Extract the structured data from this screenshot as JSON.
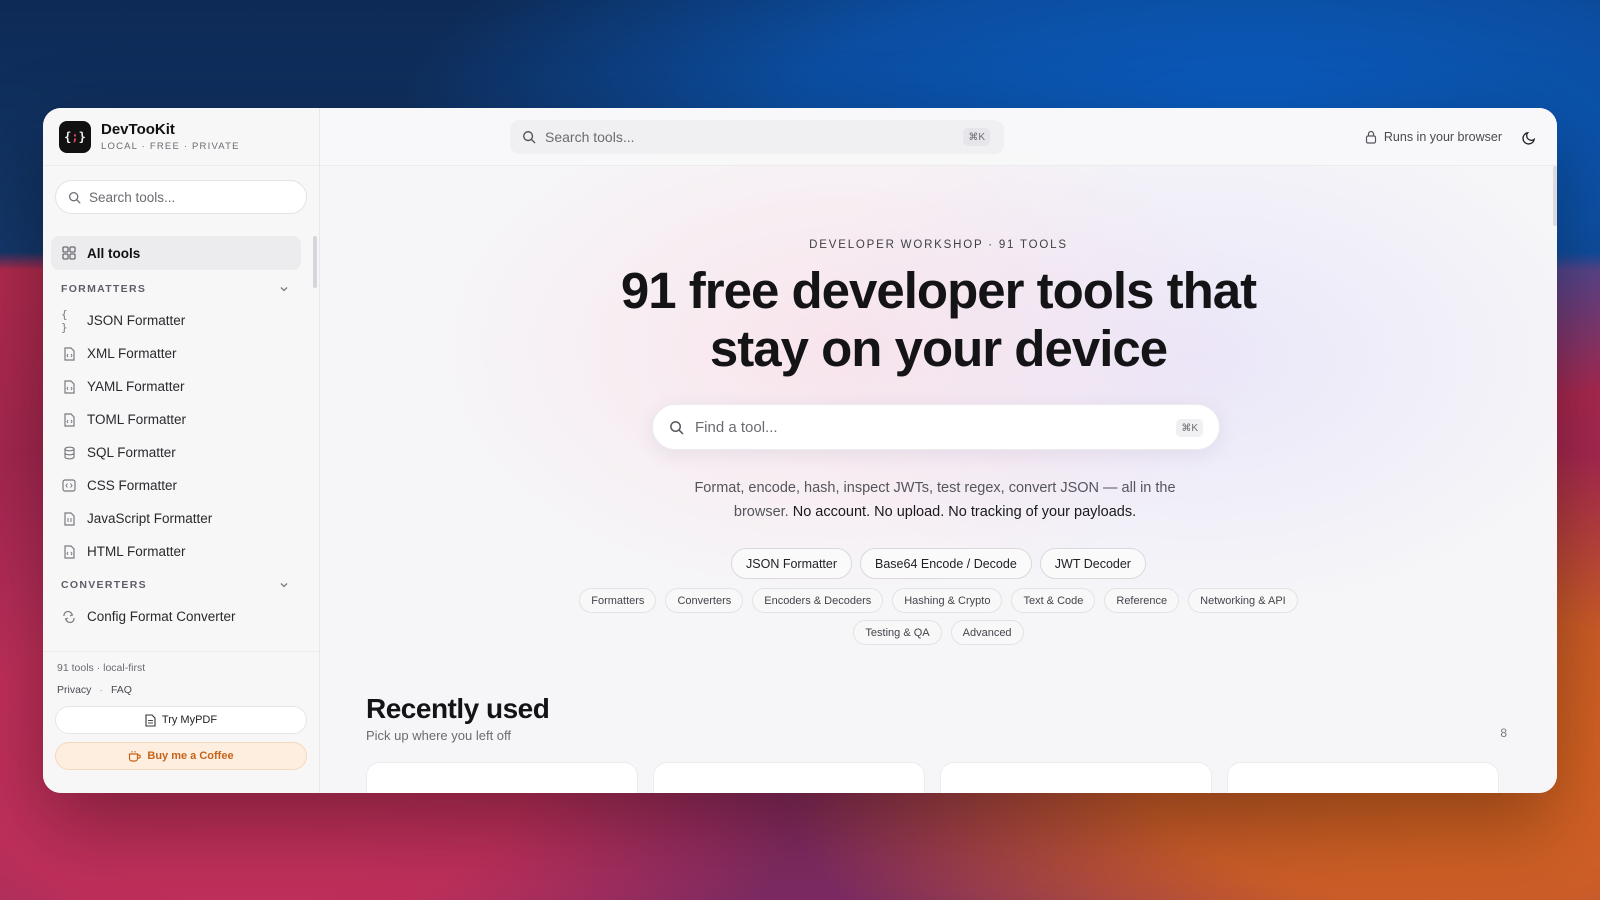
{
  "brand": {
    "name": "DevTooKit",
    "tagline": "LOCAL · FREE · PRIVATE",
    "logo_text_left": "{",
    "logo_text_mid": ";",
    "logo_text_right": "}"
  },
  "sidebar": {
    "search_placeholder": "Search tools...",
    "all_tools_label": "All tools",
    "sections": [
      {
        "title": "FORMATTERS",
        "items": [
          {
            "label": "JSON Formatter",
            "icon": "braces-icon"
          },
          {
            "label": "XML Formatter",
            "icon": "file-code-icon"
          },
          {
            "label": "YAML Formatter",
            "icon": "file-code-icon"
          },
          {
            "label": "TOML Formatter",
            "icon": "file-code-icon"
          },
          {
            "label": "SQL Formatter",
            "icon": "database-icon"
          },
          {
            "label": "CSS Formatter",
            "icon": "code-box-icon"
          },
          {
            "label": "JavaScript Formatter",
            "icon": "file-code-icon"
          },
          {
            "label": "HTML Formatter",
            "icon": "file-code-icon"
          }
        ]
      },
      {
        "title": "CONVERTERS",
        "items": [
          {
            "label": "Config Format Converter",
            "icon": "convert-arrows-icon"
          }
        ]
      }
    ],
    "footer": {
      "meta": "91 tools · local-first",
      "privacy": "Privacy",
      "separator": "·",
      "faq": "FAQ",
      "mypdf_label": "Try MyPDF",
      "coffee_label": "Buy me a Coffee"
    }
  },
  "topbar": {
    "search_placeholder": "Search tools...",
    "shortcut": "⌘K",
    "runs_label": "Runs in your browser"
  },
  "hero": {
    "eyebrow": "DEVELOPER WORKSHOP · 91 TOOLS",
    "headline_line1": "91 free developer tools that",
    "headline_line2": "stay on your device",
    "find_placeholder": "Find a tool...",
    "find_shortcut": "⌘K",
    "subtext_plain": "Format, encode, hash, inspect JWTs, test regex, convert JSON — all in the browser.",
    "subtext_strong": "No account. No upload. No tracking of your payloads.",
    "featured": [
      "JSON Formatter",
      "Base64 Encode / Decode",
      "JWT Decoder"
    ],
    "categories_row1": [
      "Formatters",
      "Converters",
      "Encoders & Decoders",
      "Hashing & Crypto",
      "Text & Code",
      "Reference",
      "Networking & API"
    ],
    "categories_row2": [
      "Testing & QA",
      "Advanced"
    ]
  },
  "recent": {
    "title": "Recently used",
    "subtitle": "Pick up where you left off",
    "count": "8"
  },
  "colors": {
    "accent_coffee": "#c6631a",
    "logo_bg": "#111111",
    "logo_accent": "#e2445b"
  }
}
